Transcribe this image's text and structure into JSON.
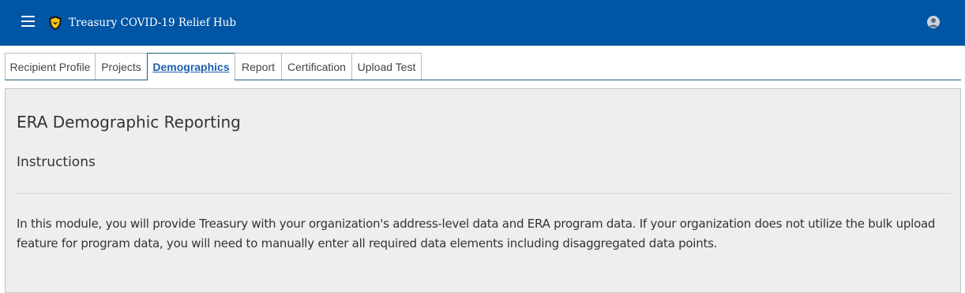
{
  "header": {
    "menu_icon": "hamburger-menu-icon",
    "logo_icon": "treasury-shield-logo",
    "app_title": "Treasury COVID-19 Relief Hub",
    "user_icon": "user-avatar-icon",
    "background_color": "#0055a5"
  },
  "tabs": [
    {
      "label": "Recipient Profile",
      "active": false
    },
    {
      "label": "Projects",
      "active": false
    },
    {
      "label": "Demographics",
      "active": true
    },
    {
      "label": "Report",
      "active": false
    },
    {
      "label": "Certification",
      "active": false
    },
    {
      "label": "Upload Test",
      "active": false
    }
  ],
  "main": {
    "title": "ERA Demographic Reporting",
    "section_title": "Instructions",
    "instructions_text": "In this module, you will provide Treasury with your organization's address-level data and ERA program data. If your organization does not utilize the bulk upload feature for program data, you will need to manually enter all required data elements including disaggregated data points."
  },
  "colors": {
    "accent": "#1f5fae",
    "panel_background": "#eeeeee"
  }
}
